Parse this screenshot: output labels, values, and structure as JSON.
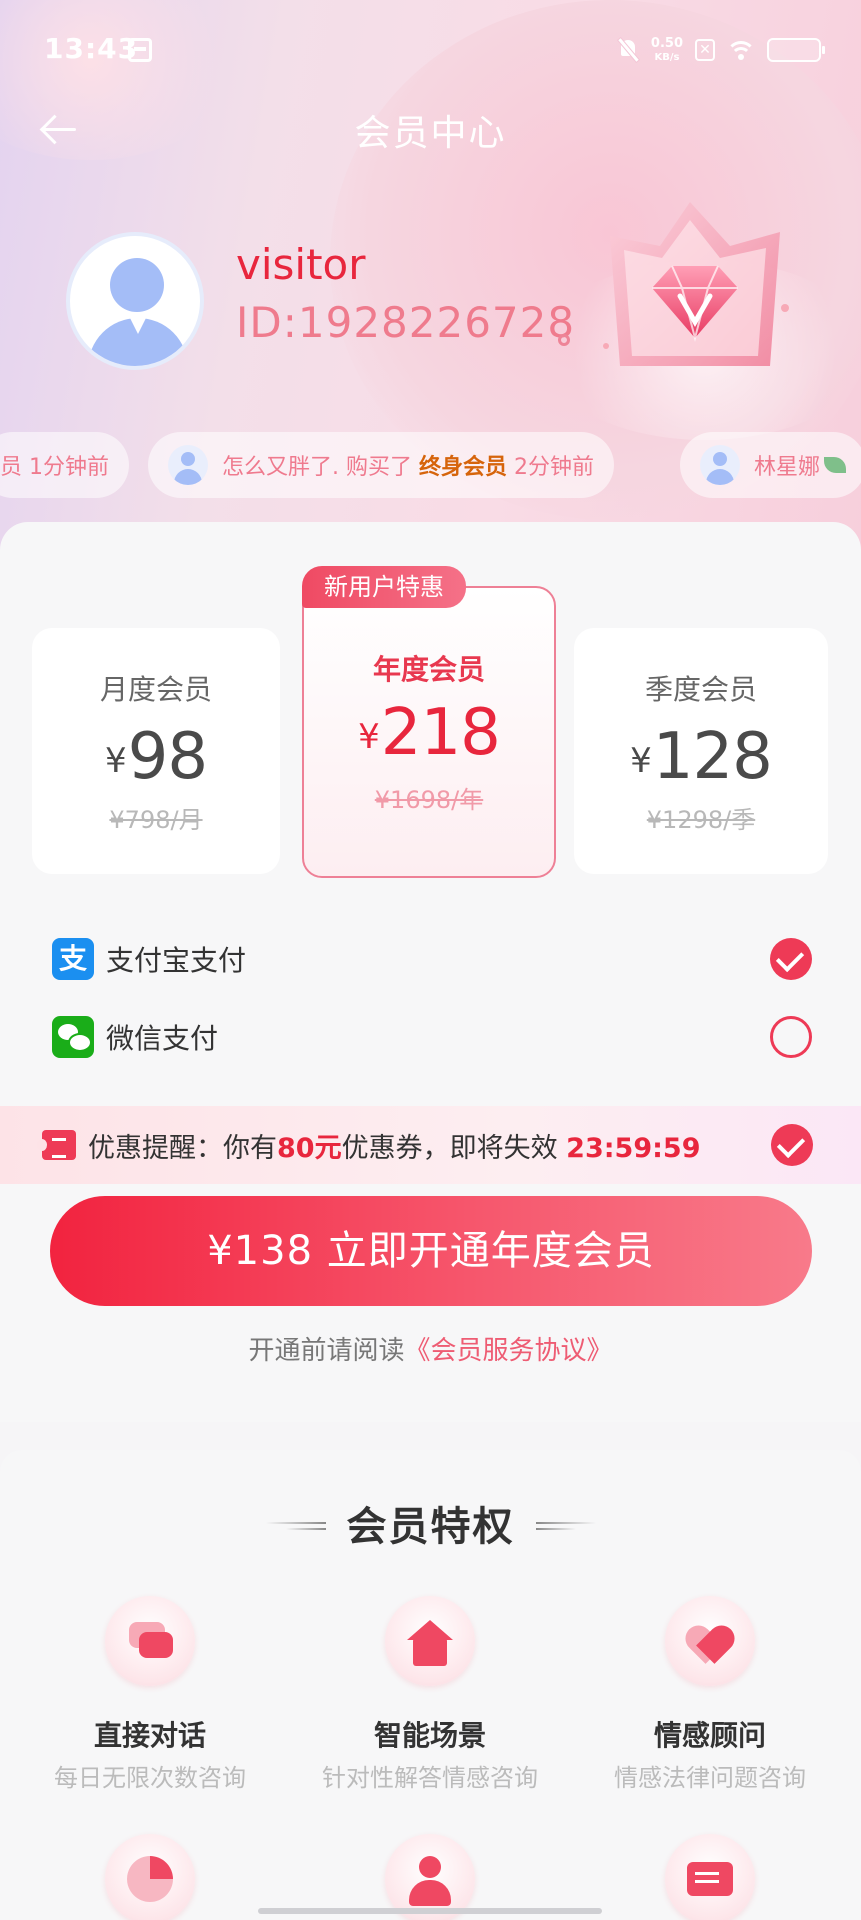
{
  "status_bar": {
    "time": "13:43",
    "speed_value": "0.50",
    "speed_unit": "KB/s",
    "notif_x": "✕"
  },
  "header": {
    "title": "会员中心"
  },
  "user": {
    "name": "visitor",
    "id": "ID:1928226728"
  },
  "ticker": [
    {
      "tail": "员 1分钟前"
    },
    {
      "user": "怎么又胖了.",
      "action": " 购买了 ",
      "product": "终身会员",
      "time": " 2分钟前"
    },
    {
      "user": "林星娜"
    }
  ],
  "plans": {
    "badge": "新用户特惠",
    "currency": "¥",
    "monthly": {
      "name": "月度会员",
      "price": "98",
      "original": "¥798/月"
    },
    "yearly": {
      "name": "年度会员",
      "price": "218",
      "original": "¥1698/年"
    },
    "quarterly": {
      "name": "季度会员",
      "price": "128",
      "original": "¥1298/季"
    }
  },
  "payment": {
    "alipay": {
      "label": "支付宝支付",
      "icon_char": "支",
      "selected": true
    },
    "wechat": {
      "label": "微信支付",
      "selected": false
    }
  },
  "promo": {
    "prefix": "优惠提醒：你有",
    "amount": "80元",
    "middle": "优惠券，即将失效 ",
    "countdown": "23:59:59"
  },
  "cta": {
    "label": "¥138 立即开通年度会员"
  },
  "agreement": {
    "prefix": "开通前请阅读",
    "link": "《会员服务协议》"
  },
  "perks": {
    "title": "会员特权",
    "items": [
      {
        "name": "直接对话",
        "desc": "每日无限次数咨询",
        "icon": "chat-bubble-icon"
      },
      {
        "name": "智能场景",
        "desc": "针对性解答情感咨询",
        "icon": "home-icon"
      },
      {
        "name": "情感顾问",
        "desc": "情感法律问题咨询",
        "icon": "heart-icon"
      },
      {
        "icon": "pie-chart-icon"
      },
      {
        "icon": "people-icon"
      },
      {
        "icon": "document-icon"
      }
    ]
  },
  "colors": {
    "accent": "#e8263d",
    "button_start": "#f2233f",
    "button_end": "#f87a8a",
    "id_text": "#ef7b8d"
  }
}
